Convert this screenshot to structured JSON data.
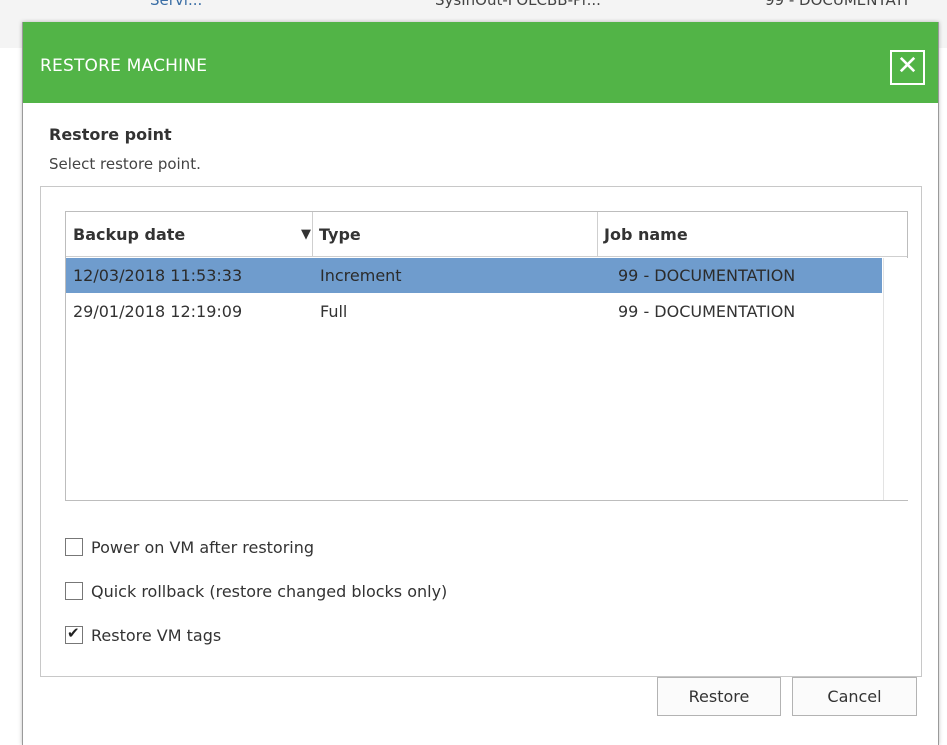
{
  "background": {
    "col1": "Servi...",
    "col2": "SysInOut-FOLCBB-Pr...",
    "col3": "99 - DOCUMENTATI"
  },
  "dialog": {
    "title": "RESTORE MACHINE",
    "close_glyph": "✕",
    "accent_color": "#52b447",
    "selection_color": "#6f9ccd"
  },
  "restore_point": {
    "heading": "Restore point",
    "subtitle": "Select restore point."
  },
  "grid": {
    "columns": [
      "Backup date",
      "Type",
      "Job name"
    ],
    "sort_icon": "▼",
    "rows": [
      {
        "backup_date": "12/03/2018 11:53:33",
        "type": "Increment",
        "job_name": "99 - DOCUMENTATION",
        "selected": true
      },
      {
        "backup_date": "29/01/2018 12:19:09",
        "type": "Full",
        "job_name": "99 - DOCUMENTATION",
        "selected": false
      }
    ]
  },
  "options": [
    {
      "label": "Power on VM after restoring",
      "checked": false
    },
    {
      "label": "Quick rollback (restore changed blocks only)",
      "checked": false
    },
    {
      "label": "Restore VM tags",
      "checked": true
    }
  ],
  "buttons": {
    "restore": "Restore",
    "cancel": "Cancel"
  }
}
